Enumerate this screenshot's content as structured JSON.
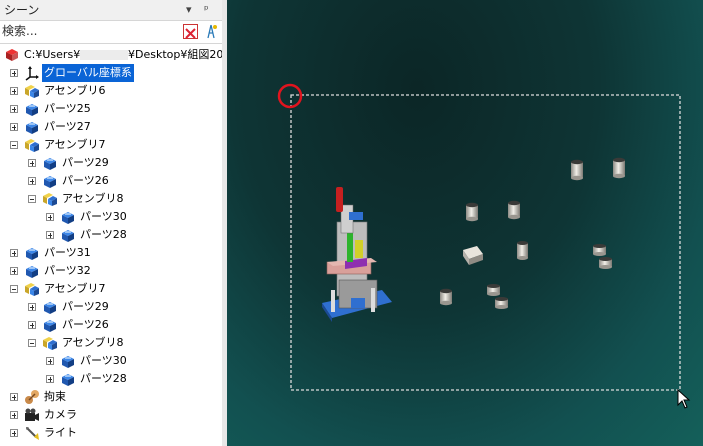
{
  "panel": {
    "title": "シーン",
    "search_placeholder": "検索..."
  },
  "tree": {
    "root_label": "C:¥Users¥",
    "root_suffix": "¥Desktop¥組図20",
    "items": [
      {
        "label": "グローバル座標系",
        "icon": "axes-icon"
      },
      {
        "label": "アセンブリ6",
        "icon": "assembly-icon"
      },
      {
        "label": "パーツ25",
        "icon": "part-icon"
      },
      {
        "label": "パーツ27",
        "icon": "part-icon"
      },
      {
        "label": "アセンブリ7",
        "icon": "assembly-icon"
      },
      {
        "label": "パーツ29",
        "icon": "part-icon"
      },
      {
        "label": "パーツ26",
        "icon": "part-icon"
      },
      {
        "label": "アセンブリ8",
        "icon": "assembly-icon"
      },
      {
        "label": "パーツ30",
        "icon": "part-icon"
      },
      {
        "label": "パーツ28",
        "icon": "part-icon"
      },
      {
        "label": "パーツ31",
        "icon": "part-icon"
      },
      {
        "label": "パーツ32",
        "icon": "part-icon"
      },
      {
        "label": "アセンブリ7",
        "icon": "assembly-icon"
      },
      {
        "label": "パーツ29",
        "icon": "part-icon"
      },
      {
        "label": "パーツ26",
        "icon": "part-icon"
      },
      {
        "label": "アセンブリ8",
        "icon": "assembly-icon"
      },
      {
        "label": "パーツ30",
        "icon": "part-icon"
      },
      {
        "label": "パーツ28",
        "icon": "part-icon"
      },
      {
        "label": "拘束",
        "icon": "constraint-icon"
      },
      {
        "label": "カメラ",
        "icon": "camera-icon"
      },
      {
        "label": "ライト",
        "icon": "light-icon"
      }
    ]
  },
  "colors": {
    "selection": "#0a64d6",
    "viewport_bg": "#0e3535",
    "highlight_circle": "#e0141e"
  }
}
